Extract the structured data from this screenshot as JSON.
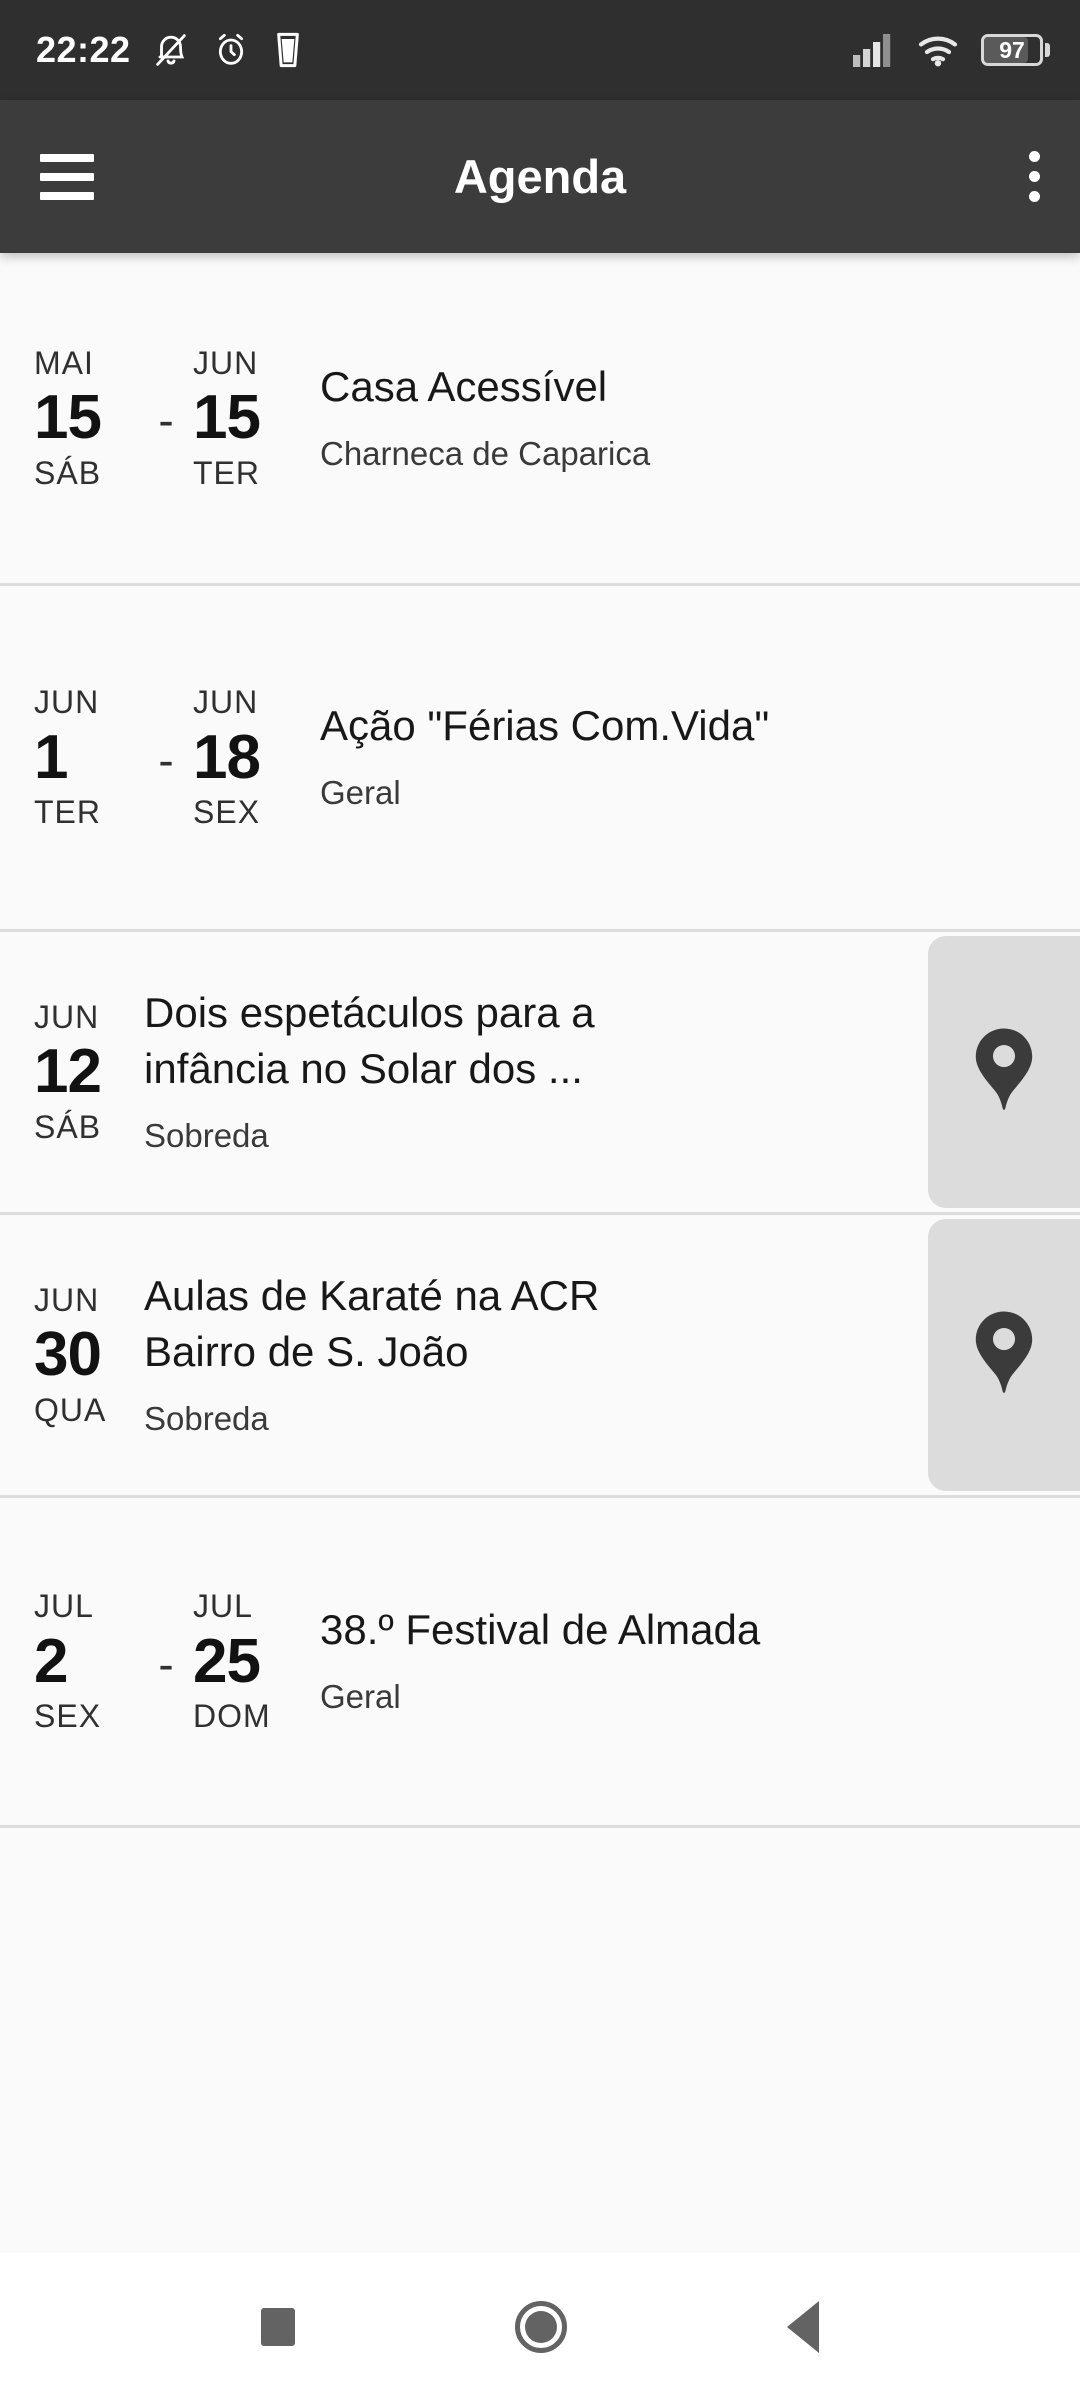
{
  "status_bar": {
    "clock": "22:22",
    "battery_percent": "97",
    "icons": [
      "bell-muted-icon",
      "alarm-clock-icon",
      "glass-icon",
      "signal-bars-icon",
      "wifi-icon",
      "battery-icon"
    ]
  },
  "app_bar": {
    "title": "Agenda",
    "menu_icon": "hamburger-menu-icon",
    "overflow_icon": "overflow-menu-icon"
  },
  "events": [
    {
      "start": {
        "month": "MAI",
        "day": "15",
        "weekday": "SÁB"
      },
      "separator": "-",
      "end": {
        "month": "JUN",
        "day": "15",
        "weekday": "TER"
      },
      "title": "Casa Acessível",
      "location": "Charneca de Caparica",
      "has_map_button": false
    },
    {
      "start": {
        "month": "JUN",
        "day": "1",
        "weekday": "TER"
      },
      "separator": "-",
      "end": {
        "month": "JUN",
        "day": "18",
        "weekday": "SEX"
      },
      "title": "Ação \"Férias Com.Vida\"",
      "location": "Geral",
      "has_map_button": false
    },
    {
      "start": {
        "month": "JUN",
        "day": "12",
        "weekday": "SÁB"
      },
      "separator": "",
      "end": null,
      "title": "Dois espetáculos para a\ninfância no Solar dos ...",
      "location": "Sobreda",
      "has_map_button": true
    },
    {
      "start": {
        "month": "JUN",
        "day": "30",
        "weekday": "QUA"
      },
      "separator": "",
      "end": null,
      "title": "Aulas de Karaté na ACR\nBairro de S. João",
      "location": "Sobreda",
      "has_map_button": true
    },
    {
      "start": {
        "month": "JUL",
        "day": "2",
        "weekday": "SEX"
      },
      "separator": "-",
      "end": {
        "month": "JUL",
        "day": "25",
        "weekday": "DOM"
      },
      "title": "38.º Festival de Almada",
      "location": "Geral",
      "has_map_button": false
    }
  ],
  "nav_bar": {
    "recents_label": "recents-square-icon",
    "home_label": "home-circle-icon",
    "back_label": "back-triangle-icon"
  },
  "colors": {
    "status_bar_bg": "#2f2f2f",
    "app_bar_bg": "#3c3c3c",
    "list_bg": "#fafafa",
    "divider": "#dddddd",
    "map_button_bg": "#dcdcdc",
    "nav_icon": "#636363"
  }
}
